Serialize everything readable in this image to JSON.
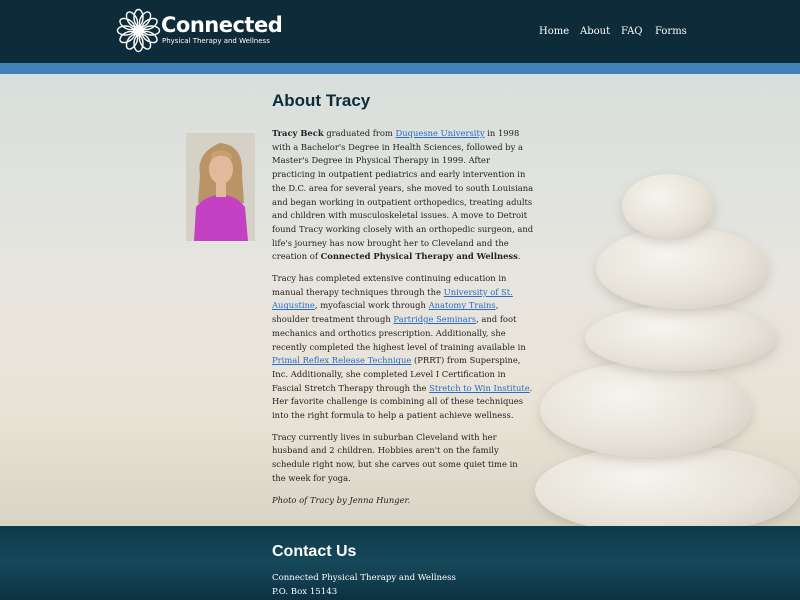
{
  "header": {
    "brand": "Connected",
    "tagline": "Physical Therapy and Wellness",
    "nav": [
      "Home",
      "About",
      "FAQ",
      "Forms"
    ]
  },
  "main": {
    "title": "About Tracy",
    "para1": {
      "name": "Tracy Beck",
      "t1": " graduated from ",
      "link1": "Duquesne University",
      "t2": " in 1998 with a Bachelor's Degree in Health Sciences, followed by a Master's Degree in Physical Therapy in 1999. After practicing in outpatient pediatrics and early intervention in the D.C. area for several years, she moved to south Louisiana and began working in outpatient orthopedics, treating adults and children with musculoskeletal issues. A move to Detroit found Tracy working closely with an orthopedic surgeon, and life's journey has now brought her to Cleveland and the creation of ",
      "bold_end": "Connected Physical Therapy and Wellness",
      "t3": "."
    },
    "para2": {
      "t1": "Tracy has completed extensive continuing education in manual therapy techniques through the ",
      "link1": "University of St. Augustine",
      "t2": ", myofascial work through ",
      "link2": "Anatomy Trains",
      "t3": ", shoulder treatment through ",
      "link3": "Partridge Seminars",
      "t4": ", and foot mechanics and orthotics prescription. Additionally, she recently completed the highest level of training available in ",
      "link4": "Primal Reflex Release Technique",
      "t5": " (PRRT) from Superspine, Inc. Additionally, she completed Level I Certification in Fascial Stretch Therapy through the ",
      "link5": "Stretch to Win Institute",
      "t6": ". Her favorite challenge is combining all of these techniques into the right formula to help a patient achieve wellness."
    },
    "para3": "Tracy currently lives in suburban Cleveland with her husband and 2 children. Hobbies aren't on the family schedule right now, but she carves out some quiet time in the week for yoga.",
    "caption": "Photo of Tracy by Jenna Hunger."
  },
  "footer": {
    "title": "Contact Us",
    "lines": [
      "Connected Physical Therapy and Wellness",
      "P.O. Box 15143"
    ]
  },
  "colors": {
    "header_bg": "#0e2b3a",
    "stripe": "#3f82ba",
    "link": "#2a6cc4",
    "footer_bg": "#16495b"
  }
}
